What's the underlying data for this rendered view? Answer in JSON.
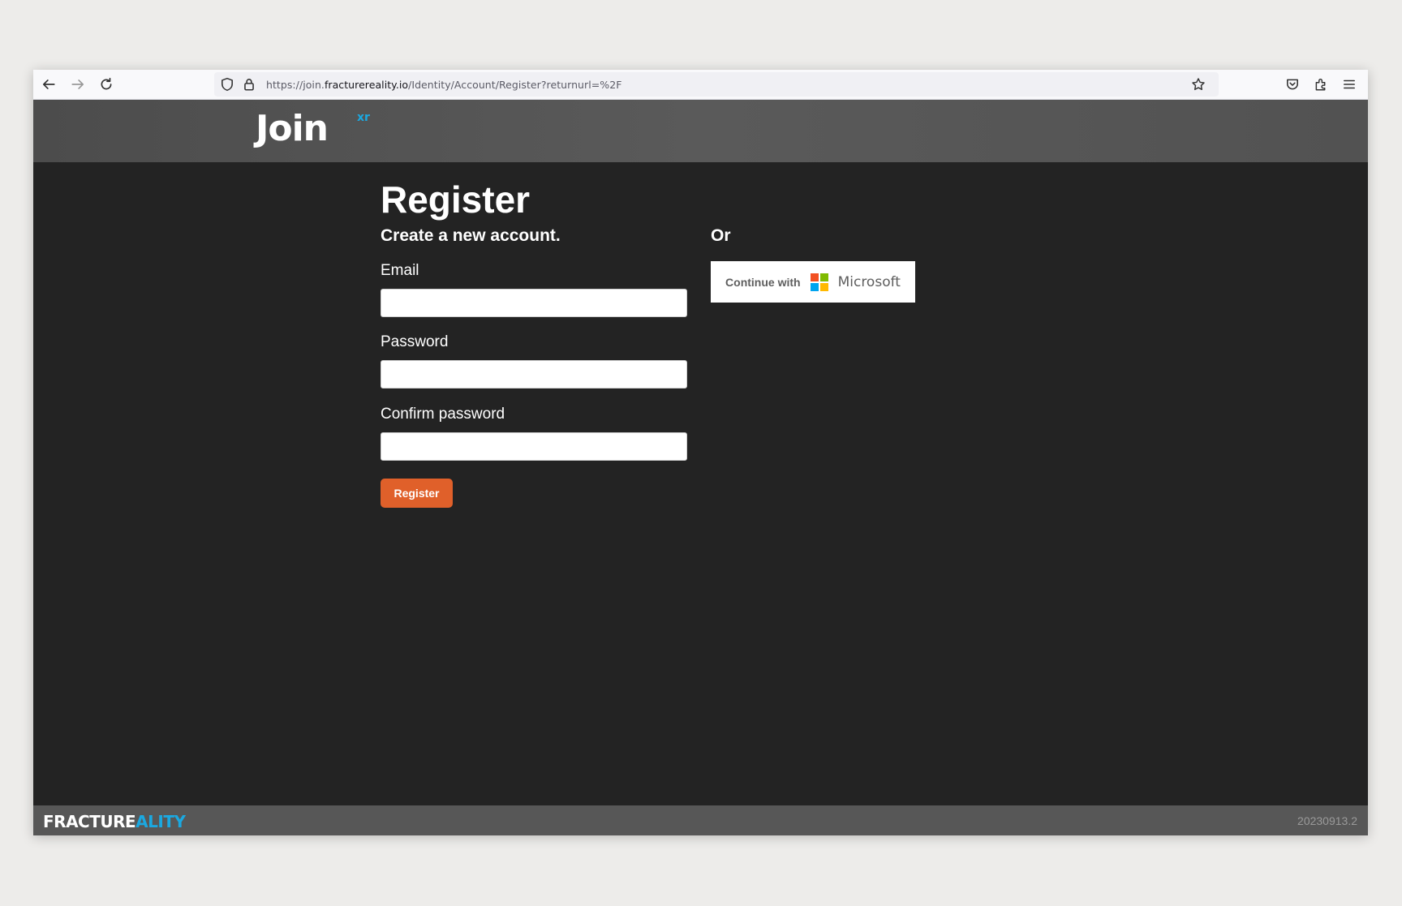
{
  "browser": {
    "url_prefix": "https://join.",
    "url_host": "fracturereality.io",
    "url_path": "/Identity/Account/Register?returnurl=%2F"
  },
  "header": {
    "logo_text": "Join",
    "logo_superscript": "xr"
  },
  "main": {
    "title": "Register",
    "subtitle": "Create a new account.",
    "email_label": "Email",
    "password_label": "Password",
    "confirm_password_label": "Confirm password",
    "email_value": "",
    "password_value": "",
    "confirm_password_value": "",
    "register_button": "Register",
    "or_label": "Or",
    "continue_with": "Continue with",
    "provider_name": "Microsoft"
  },
  "footer": {
    "brand_part1": "FRACTU",
    "brand_part2": "RE",
    "brand_part3": "ALITY",
    "version": "20230913.2"
  },
  "colors": {
    "accent_orange": "#e0602a",
    "brand_blue": "#1ba8e0",
    "page_background": "#232323",
    "microsoft_red": "#f25022",
    "microsoft_green": "#7fba00",
    "microsoft_blue": "#00a4ef",
    "microsoft_yellow": "#ffb900"
  },
  "icons": [
    "back-arrow-icon",
    "forward-arrow-icon",
    "reload-icon",
    "shield-icon",
    "lock-icon",
    "bookmark-star-icon",
    "pocket-icon",
    "extensions-icon",
    "menu-icon",
    "microsoft-logo-icon"
  ]
}
